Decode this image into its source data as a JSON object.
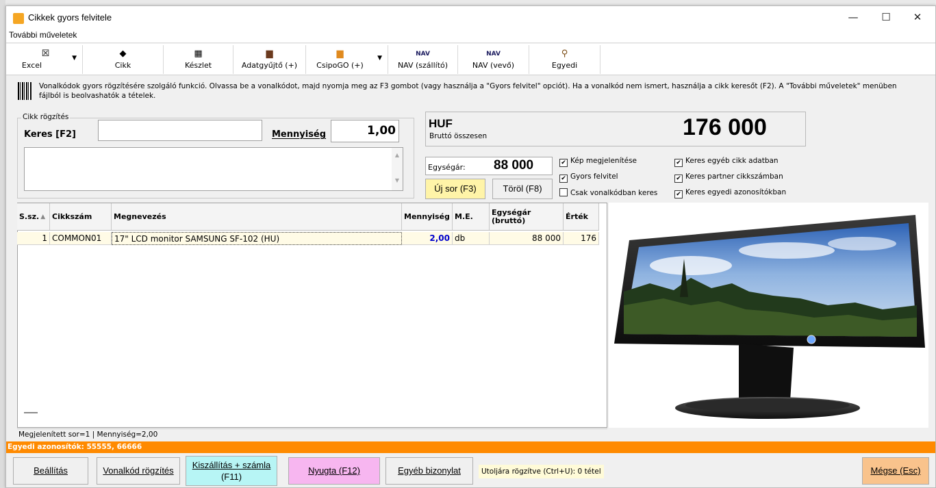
{
  "window": {
    "title": "Cikkek gyors felvitele",
    "min": "—",
    "max": "☐",
    "close": "✕"
  },
  "menu": {
    "more_ops": "További műveletek"
  },
  "toolbar": [
    {
      "label": "Excel",
      "icon": "☒",
      "icon_name": "excel-icon",
      "dropdown": true
    },
    {
      "label": "Cikk",
      "icon": "◆",
      "icon_name": "item-icon"
    },
    {
      "label": "Készlet",
      "icon": "▦",
      "icon_name": "stock-icon"
    },
    {
      "label": "Adatgyűjtő (+)",
      "icon": "▆",
      "icon_name": "data-collector-icon"
    },
    {
      "label": "CsipoGO (+)",
      "icon": "▆",
      "icon_name": "csipogo-icon",
      "dropdown": true
    },
    {
      "label": "NAV (szállító)",
      "icon": "NAV",
      "icon_name": "nav-supplier-icon"
    },
    {
      "label": "NAV (vevő)",
      "icon": "NAV",
      "icon_name": "nav-customer-icon"
    },
    {
      "label": "Egyedi",
      "icon": "⚲",
      "icon_name": "key-icon"
    }
  ],
  "info": {
    "line1": "Vonalkódok gyors rögzítésére szolgáló funkció. Olvassa be a vonalkódot, majd nyomja meg az F3 gombot (vagy használja a \"Gyors felvitel\" opciót). Ha a vonalkód nem ismert, használja a cikk keresőt (F2). A \"További műveletek\" menüben",
    "line2": "fájlból is beolvashatók a tételek."
  },
  "form": {
    "group_label": "Cikk rögzítés",
    "search_label": "Keres [F2]",
    "search_value": "",
    "qty_label": "Mennyiség",
    "qty_value": "1,00",
    "memo_value": ""
  },
  "totals": {
    "currency": "HUF",
    "gross_label": "Bruttó összesen",
    "total": "176 000",
    "unit_price_label": "Egységár:",
    "unit_price": "88 000"
  },
  "buttons": {
    "new_row": "Új sor (F3)",
    "delete": "Töröl (F8)",
    "settings": "Beállítás",
    "barcode": "Vonalkód rögzítés",
    "delivery_line1": "Kiszállítás + számla",
    "delivery_line2": "(F11)",
    "receipt": "Nyugta (F12)",
    "other_doc": "Egyéb bizonylat",
    "cancel": "Mégse (Esc)"
  },
  "checkboxes": [
    {
      "label": "Kép megjelenítése",
      "checked": true
    },
    {
      "label": "Gyors felvitel",
      "checked": true
    },
    {
      "label": "Csak vonalkódban keres",
      "checked": false
    },
    {
      "label": "Keres egyéb cikk adatban",
      "checked": true
    },
    {
      "label": "Keres partner cikkszámban",
      "checked": true
    },
    {
      "label": "Keres egyedi azonosítókban",
      "checked": true
    }
  ],
  "table": {
    "headers": [
      "S.sz.",
      "Cikkszám",
      "Megnevezés",
      "Mennyiség",
      "M.E.",
      "Egységár (bruttó)",
      "Érték"
    ],
    "rows": [
      {
        "ssz": "1",
        "code": "COMMON01",
        "name": "17\" LCD monitor SAMSUNG SF-102 (HU)",
        "qty": "2,00",
        "unit": "db",
        "price": "88 000",
        "value": "176"
      }
    ]
  },
  "status": {
    "rows_info": "Megjelenített sor=1 | Mennyiség=2,00",
    "unique_ids": "Egyedi azonosítók: 55555, 66666",
    "last_recorded": "Utoljára rögzítve (Ctrl+U): 0 tétel"
  },
  "colors": {
    "orange": "#ff8a00",
    "delivery_bg": "#b7f5f5",
    "receipt_bg": "#f7b6f0",
    "cancel_bg": "#f9c38c",
    "new_row_bg": "#fff4a8",
    "row_bg": "#fffbe6"
  }
}
